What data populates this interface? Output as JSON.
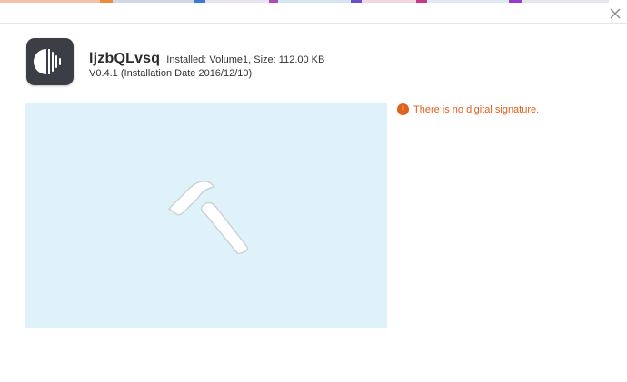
{
  "window": {
    "close_icon": "close-icon"
  },
  "app": {
    "icon": "audio-waveform-app-icon",
    "name": "ljzbQLvsq",
    "install_info": "Installed: Volume1, Size: 112.00 KB",
    "version_line": "V0.4.1 (Installation Date 2016/12/10)"
  },
  "preview": {
    "placeholder_icon": "hammer-icon",
    "background_color": "#dff2fa"
  },
  "warning": {
    "icon": "warning-icon",
    "text": "There is no digital signature.",
    "color": "#e0601c"
  }
}
